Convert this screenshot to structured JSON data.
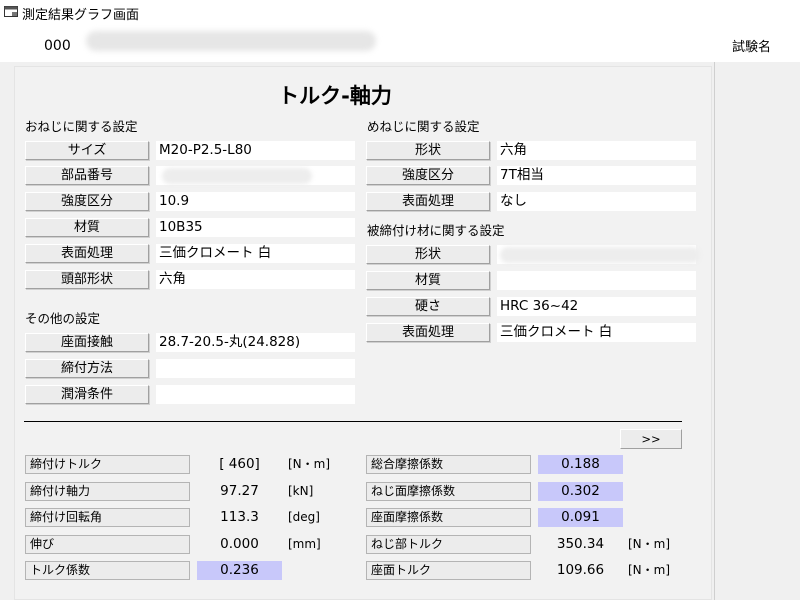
{
  "window": {
    "title": "測定結果グラフ画面"
  },
  "header": {
    "id": "000",
    "test_name_label": "試験名"
  },
  "page_title": "トルク-軸力",
  "bolt": {
    "heading": "おねじに関する設定",
    "rows": [
      {
        "label": "サイズ",
        "value": "M20-P2.5-L80"
      },
      {
        "label": "部品番号",
        "value": ""
      },
      {
        "label": "強度区分",
        "value": "10.9"
      },
      {
        "label": "材質",
        "value": "10B35"
      },
      {
        "label": "表面処理",
        "value": "三価クロメート 白"
      },
      {
        "label": "頭部形状",
        "value": "六角"
      }
    ]
  },
  "other": {
    "heading": "その他の設定",
    "rows": [
      {
        "label": "座面接触",
        "value": "28.7-20.5-丸(24.828)"
      },
      {
        "label": "締付方法",
        "value": ""
      },
      {
        "label": "潤滑条件",
        "value": ""
      }
    ]
  },
  "nut": {
    "heading": "めねじに関する設定",
    "rows": [
      {
        "label": "形状",
        "value": "六角"
      },
      {
        "label": "強度区分",
        "value": "7T相当"
      },
      {
        "label": "表面処理",
        "value": "なし"
      }
    ]
  },
  "clamped": {
    "heading": "被締付け材に関する設定",
    "rows": [
      {
        "label": "形状",
        "value": ""
      },
      {
        "label": "材質",
        "value": ""
      },
      {
        "label": "硬さ",
        "value": "HRC 36~42"
      },
      {
        "label": "表面処理",
        "value": "三価クロメート 白"
      }
    ]
  },
  "next_button": ">>",
  "results_left": [
    {
      "label": "締付けトルク",
      "value": "[ 460]",
      "unit": "[N・m]",
      "highlight": false
    },
    {
      "label": "締付け軸力",
      "value": "97.27",
      "unit": "[kN]",
      "highlight": false
    },
    {
      "label": "締付け回転角",
      "value": "113.3",
      "unit": "[deg]",
      "highlight": false
    },
    {
      "label": "伸び",
      "value": "0.000",
      "unit": "[mm]",
      "highlight": false
    },
    {
      "label": "トルク係数",
      "value": "0.236",
      "unit": "",
      "highlight": true
    }
  ],
  "results_right": [
    {
      "label": "総合摩擦係数",
      "value": "0.188",
      "unit": "",
      "highlight": true
    },
    {
      "label": "ねじ面摩擦係数",
      "value": "0.302",
      "unit": "",
      "highlight": true
    },
    {
      "label": "座面摩擦係数",
      "value": "0.091",
      "unit": "",
      "highlight": true
    },
    {
      "label": "ねじ部トルク",
      "value": "350.34",
      "unit": "[N・m]",
      "highlight": false
    },
    {
      "label": "座面トルク",
      "value": "109.66",
      "unit": "[N・m]",
      "highlight": false
    }
  ],
  "colors": {
    "highlight": "#c8c8fa"
  }
}
